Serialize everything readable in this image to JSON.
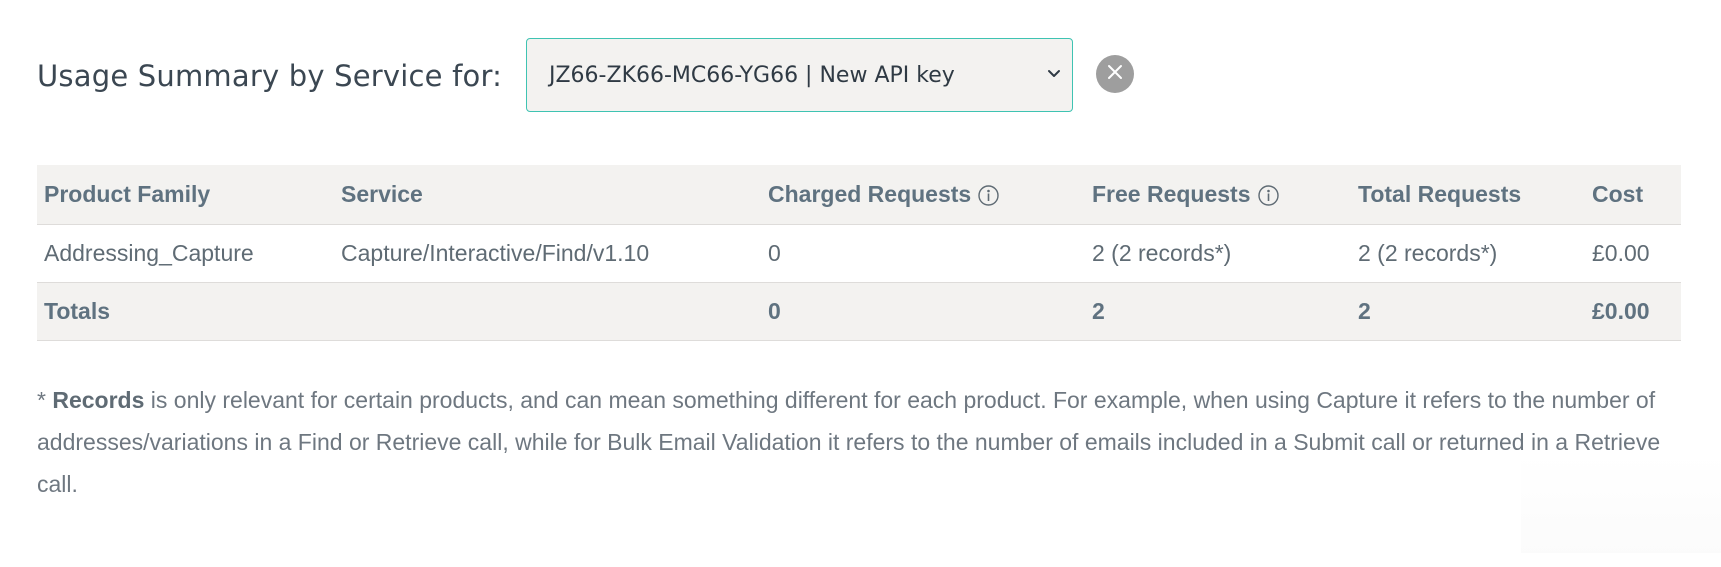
{
  "header": {
    "title": "Usage Summary by Service for:"
  },
  "api_key_select": {
    "selected": "JZ66-ZK66-MC66-YG66 | New API key"
  },
  "clear_button": {
    "icon": "close-icon",
    "symbol": "X"
  },
  "table": {
    "headers": {
      "product_family": "Product Family",
      "service": "Service",
      "charged_requests": "Charged Requests",
      "free_requests": "Free Requests",
      "total_requests": "Total Requests",
      "cost": "Cost"
    },
    "rows": [
      {
        "product_family": "Addressing_Capture",
        "service": "Capture/Interactive/Find/v1.10",
        "charged_requests": "0",
        "free_requests": "2 (2 records*)",
        "total_requests": "2 (2 records*)",
        "cost": "£0.00"
      }
    ],
    "totals": {
      "label": "Totals",
      "charged_requests": "0",
      "free_requests": "2",
      "total_requests": "2",
      "cost": "£0.00"
    }
  },
  "footnote": {
    "prefix": "* ",
    "bold": "Records",
    "text": " is only relevant for certain products, and can mean something different for each product. For example, when using Capture it refers to the number of addresses/variations in a Find or Retrieve call, while for Bulk Email Validation it refers to the number of emails included in a Submit call or returned in a Retrieve call."
  },
  "colors": {
    "accent_border": "#3fc3b2",
    "header_bg": "#f3f2f0",
    "clear_button_bg": "#9e9e9e"
  }
}
